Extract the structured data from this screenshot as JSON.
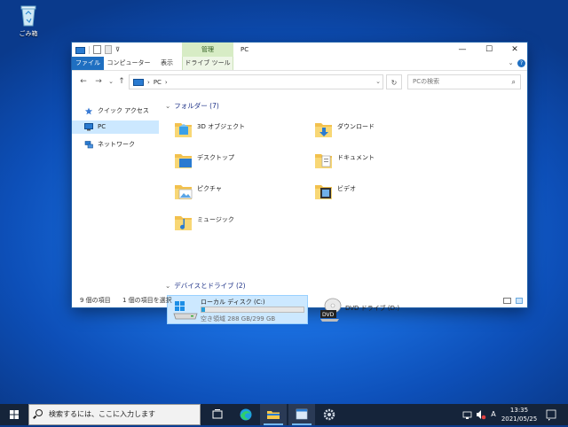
{
  "desktop": {
    "recycle_bin_label": "ごみ箱"
  },
  "window": {
    "title": "PC",
    "context_tab_title": "管理",
    "controls": {
      "minimize": "—",
      "maximize": "☐",
      "close": "✕"
    },
    "ribbon_tabs": [
      {
        "label": "ファイル"
      },
      {
        "label": "コンピューター"
      },
      {
        "label": "表示"
      },
      {
        "label": "ドライブ ツール"
      }
    ]
  },
  "navigation": {
    "back": "←",
    "forward": "→",
    "recent": "⌄",
    "up": "↑",
    "address_crumbs": [
      "PC",
      "›"
    ],
    "address_sep": "›",
    "refresh": "↻",
    "search_placeholder": "PCの検索",
    "search_icon": "⌕"
  },
  "nav_pane": {
    "items": [
      {
        "label": "クイック アクセス",
        "icon": "star-icon"
      },
      {
        "label": "PC",
        "icon": "pc-icon",
        "selected": true
      },
      {
        "label": "ネットワーク",
        "icon": "network-icon"
      }
    ]
  },
  "folders_group": {
    "label": "フォルダー (7)"
  },
  "folders": [
    {
      "label": "3D オブジェクト",
      "icon": "3d-objects-icon"
    },
    {
      "label": "ダウンロード",
      "icon": "downloads-icon"
    },
    {
      "label": "デスクトップ",
      "icon": "desktop-folder-icon"
    },
    {
      "label": "ドキュメント",
      "icon": "documents-icon"
    },
    {
      "label": "ピクチャ",
      "icon": "pictures-icon"
    },
    {
      "label": "ビデオ",
      "icon": "videos-icon"
    },
    {
      "label": "ミュージック",
      "icon": "music-icon"
    }
  ],
  "drives_group": {
    "label": "デバイスとドライブ (2)"
  },
  "drives": [
    {
      "name": "ローカル ディスク (C:)",
      "free_text": "空き領域 288 GB/299 GB",
      "used_fraction": 0.037,
      "selected": true
    },
    {
      "name": "DVD ドライブ (D:)",
      "dvd_label": "DVD"
    }
  ],
  "status": {
    "item_count": "9 個の項目",
    "selection": "1 個の項目を選択"
  },
  "taskbar": {
    "search_placeholder": "検索するには、ここに入力します",
    "ime": "A",
    "time": "13:35",
    "date": "2021/05/25"
  },
  "colors": {
    "accent": "#1f6fc1",
    "selection": "#cce8ff",
    "folder": "#f8d775",
    "taskbar": "#15243a"
  }
}
